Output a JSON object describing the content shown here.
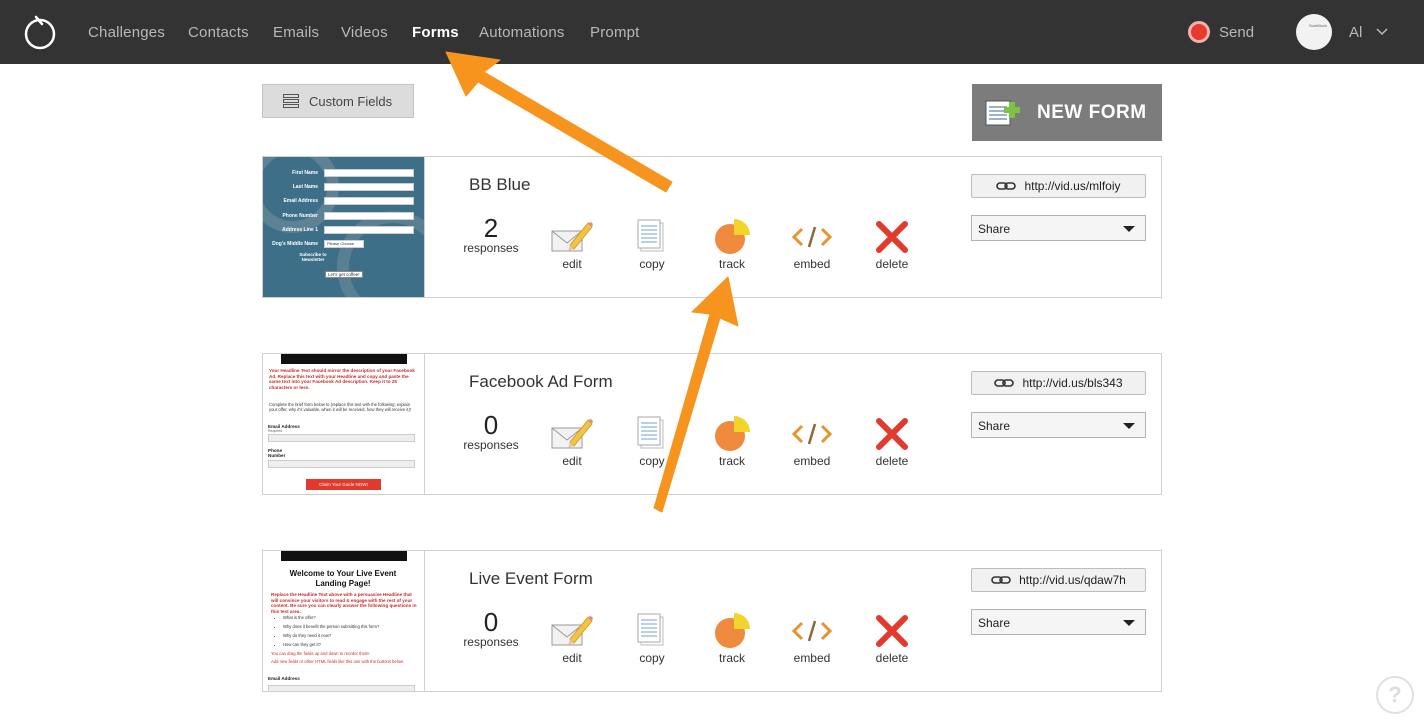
{
  "nav": {
    "items": [
      {
        "label": "Challenges"
      },
      {
        "label": "Contacts"
      },
      {
        "label": "Emails"
      },
      {
        "label": "Videos"
      },
      {
        "label": "Forms"
      },
      {
        "label": "Automations"
      },
      {
        "label": "Prompt"
      }
    ],
    "active": "Forms",
    "send_label": "Send",
    "user_name": "Al"
  },
  "toolbar": {
    "custom_fields_label": "Custom Fields",
    "new_form_label": "NEW FORM"
  },
  "actions": {
    "edit": "edit",
    "copy": "copy",
    "track": "track",
    "embed": "embed",
    "delete": "delete"
  },
  "forms": [
    {
      "title": "BB Blue",
      "responses": "2",
      "responses_label": "responses",
      "link": "http://vid.us/mlfoiy",
      "share_label": "Share"
    },
    {
      "title": "Facebook Ad Form",
      "responses": "0",
      "responses_label": "responses",
      "link": "http://vid.us/bls343",
      "share_label": "Share"
    },
    {
      "title": "Live Event Form",
      "responses": "0",
      "responses_label": "responses",
      "link": "http://vid.us/qdaw7h",
      "share_label": "Share"
    }
  ],
  "thumbnails": {
    "bb_blue": {
      "fields": [
        "First Name",
        "Last Name",
        "Email Address",
        "Phone Number",
        "Address Line 1",
        "Dog's Middle Name"
      ],
      "select_placeholder": "Please Choose",
      "subscribe": "Subscribe to Newsletter",
      "button": "Let's get coffee!"
    },
    "facebook": {
      "headline": "Your Headline Text should mirror the description of your Facebook Ad. Replace this text with your Headline and copy and paste the same text into your Facebook Ad description. Keep it to 25 characters or less.",
      "body": "Complete the brief form below to (replace this text with the following: explain your offer, why it's valuable, when it will be received, how they will receive it)!",
      "email_label": "Email Address",
      "phone_label": "Phone Number",
      "required": "Required",
      "button": "Claim Your Guide NOW!"
    },
    "live_event": {
      "heading": "Welcome to Your Live Event Landing Page!",
      "intro": "Replace the Headline Text above with a persuasive Headline that will convince your visitors to read & engage with the rest of your content. Be sure you can clearly answer the following questions in this text area:",
      "bullets": [
        "What is the offer?",
        "Why does it benefit the person submitting this form?",
        "Why do they need it now?",
        "How can they get it?"
      ],
      "note1": "You can drag the fields up and down to reorder them!",
      "note2": "Add new fields or other HTML fields like this one with the buttons below.",
      "email_label": "Email Address"
    }
  },
  "avatar_text": "SumBlock",
  "help_label": "?",
  "colors": {
    "nav_bg": "#333333",
    "accent_orange": "#f7941d",
    "delete_red": "#e23b2e",
    "send_red": "#e83a2f"
  },
  "icons": {
    "edit": "envelope-pencil-icon",
    "copy": "document-copy-icon",
    "track": "pie-chart-icon",
    "embed": "code-brackets-icon",
    "delete": "red-x-icon",
    "link": "chain-link-icon"
  }
}
